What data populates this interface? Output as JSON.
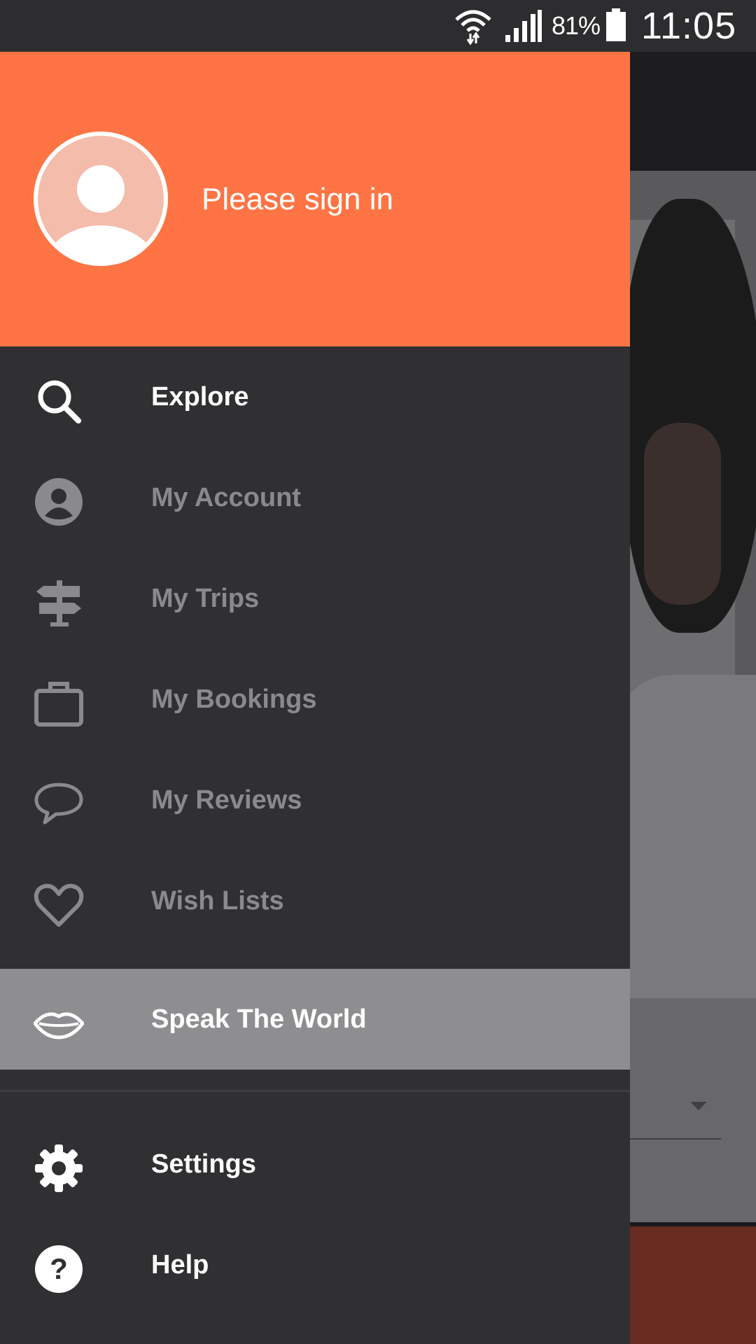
{
  "status_bar": {
    "battery_percent": "81%",
    "time": "11:05",
    "icons": [
      "wifi-icon",
      "signal-icon",
      "battery-icon"
    ]
  },
  "drawer": {
    "header": {
      "avatar_icon": "user-avatar-icon",
      "sign_in_text": "Please sign in",
      "background_color": "#ff7444"
    },
    "items": [
      {
        "label": "Explore",
        "icon": "search-icon",
        "state": "active"
      },
      {
        "label": "My Account",
        "icon": "account-circle-icon",
        "state": "muted"
      },
      {
        "label": "My Trips",
        "icon": "signpost-icon",
        "state": "muted"
      },
      {
        "label": "My Bookings",
        "icon": "briefcase-icon",
        "state": "muted"
      },
      {
        "label": "My Reviews",
        "icon": "speech-bubble-icon",
        "state": "muted"
      },
      {
        "label": "Wish Lists",
        "icon": "heart-icon",
        "state": "muted"
      },
      {
        "label": "Speak The World",
        "icon": "lips-icon",
        "state": "selected"
      }
    ],
    "footer_items": [
      {
        "label": "Settings",
        "icon": "gear-icon"
      },
      {
        "label": "Help",
        "icon": "help-icon"
      }
    ]
  }
}
